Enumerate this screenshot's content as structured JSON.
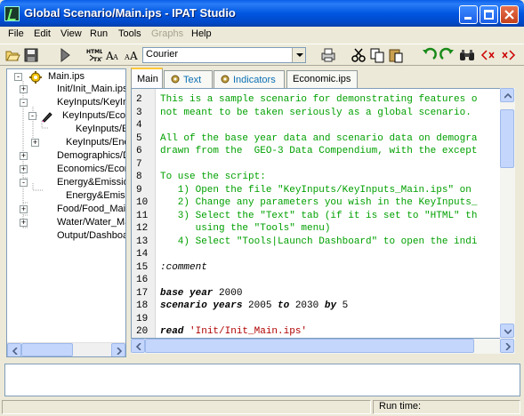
{
  "window": {
    "title": "Global Scenario/Main.ips  -  IPAT Studio",
    "caption_buttons": [
      "minimize",
      "maximize",
      "close"
    ]
  },
  "menu": [
    {
      "label": "File",
      "disabled": false
    },
    {
      "label": "Edit",
      "disabled": false
    },
    {
      "label": "View",
      "disabled": false
    },
    {
      "label": "Run",
      "disabled": false
    },
    {
      "label": "Tools",
      "disabled": false
    },
    {
      "label": "Graphs",
      "disabled": true
    },
    {
      "label": "Help",
      "disabled": false
    }
  ],
  "toolbar": {
    "font_value": "Courier",
    "icons": [
      "open-icon",
      "save-icon",
      "run-icon",
      "html-to-text-icon",
      "font-large-icon",
      "font-small-icon",
      "print-icon",
      "cut-icon",
      "copy-icon",
      "paste-icon",
      "undo-icon",
      "redo-icon",
      "find-icon",
      "prev-tag-icon",
      "next-tag-icon"
    ]
  },
  "tree": {
    "items": [
      {
        "label": "Main.ips",
        "expander": "-"
      },
      {
        "label": "Init/Init_Main.ips",
        "expander": "+"
      },
      {
        "label": "KeyInputs/KeyInputs_Main.ips",
        "expander": "-"
      },
      {
        "label": "KeyInputs/Economic.ips",
        "expander": "-"
      },
      {
        "label": "KeyInputs/Economic_Main.ips",
        "expander": ""
      },
      {
        "label": "KeyInputs/Energy.ips",
        "expander": "+"
      },
      {
        "label": "Demographics/Demographics.ips",
        "expander": "+"
      },
      {
        "label": "Economics/Economics.ips",
        "expander": "+"
      },
      {
        "label": "Energy&Emissions/Energy.ips",
        "expander": "-"
      },
      {
        "label": "Energy&Emissions/Emissions.ips",
        "expander": ""
      },
      {
        "label": "Food/Food_Main.ips",
        "expander": "+"
      },
      {
        "label": "Water/Water_Main.ips",
        "expander": "+"
      },
      {
        "label": "Output/Dashboard.ips",
        "expander": ""
      }
    ]
  },
  "tabs": [
    {
      "label": "Main",
      "active": true
    },
    {
      "label": "Text",
      "active": false
    },
    {
      "label": "Indicators",
      "active": false
    },
    {
      "label": "Economic.ips",
      "active": false
    }
  ],
  "editor": {
    "lines": [
      {
        "n": "2",
        "text": "This is a sample scenario for demonstrating features o",
        "style": "comment-green"
      },
      {
        "n": "3",
        "text": "not meant to be taken seriously as a global scenario.",
        "style": "comment-green"
      },
      {
        "n": "4",
        "text": "",
        "style": "comment-green"
      },
      {
        "n": "5",
        "text": "All of the base year data and scenario data on demogra",
        "style": "comment-green"
      },
      {
        "n": "6",
        "text": "drawn from the  GEO-3 Data Compendium, with the except",
        "style": "comment-green"
      },
      {
        "n": "7",
        "text": "",
        "style": "comment-green"
      },
      {
        "n": "8",
        "text": "To use the script:",
        "style": "comment-green"
      },
      {
        "n": "9",
        "text": "   1) Open the file \"KeyInputs/KeyInputs_Main.ips\" on",
        "style": "comment-green"
      },
      {
        "n": "10",
        "text": "   2) Change any parameters you wish in the KeyInputs_",
        "style": "comment-green"
      },
      {
        "n": "11",
        "text": "   3) Select the \"Text\" tab (if it is set to \"HTML\" th",
        "style": "comment-green"
      },
      {
        "n": "12",
        "text": "      using the \"Tools\" menu)",
        "style": "comment-green"
      },
      {
        "n": "13",
        "text": "   4) Select \"Tools|Launch Dashboard\" to open the indi",
        "style": "comment-green"
      },
      {
        "n": "14",
        "text": "",
        "style": "comment-green"
      },
      {
        "n": "15",
        "text": ":comment",
        "style": "keyword"
      },
      {
        "n": "16",
        "text": "",
        "style": "plain"
      },
      {
        "n": "17",
        "text": "base year 2000",
        "style": "stmt"
      },
      {
        "n": "18",
        "text": "scenario years 2005 to 2030 by 5",
        "style": "stmt"
      },
      {
        "n": "19",
        "text": "",
        "style": "plain"
      },
      {
        "n": "20",
        "text": "read 'Init/Init_Main.ips'",
        "style": "stmt"
      }
    ]
  },
  "statusbar": {
    "run_time_label": "Run time:"
  }
}
